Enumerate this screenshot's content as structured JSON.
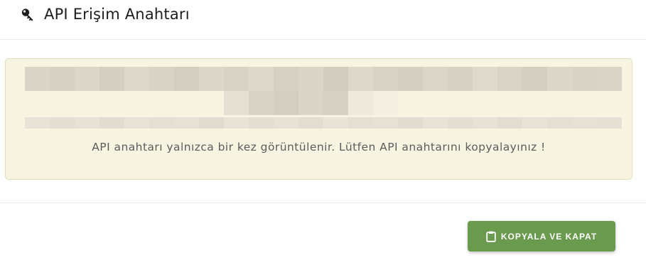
{
  "modal": {
    "title": "API Erişim Anahtarı",
    "title_icon": "key-icon"
  },
  "key_box": {
    "masked_key": "[redacted]",
    "notice": "API anahtarı yalnızca bir kez görüntülenir. Lütfen API anahtarını kopyalayınız !"
  },
  "footer": {
    "copy_close_label": "KOPYALA VE KAPAT",
    "copy_close_icon": "clipboard-icon"
  },
  "colors": {
    "key_box_bg": "#f8f4e2",
    "key_box_border": "#e5dcb8",
    "primary_button": "#6a9a4e"
  }
}
